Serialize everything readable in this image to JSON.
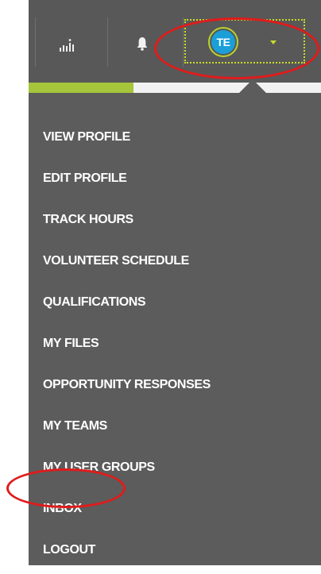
{
  "header": {
    "stats_icon": "bar-chart-icon",
    "notifications_icon": "bell-icon",
    "avatar_initials": "TE",
    "dropdown_icon": "caret-down-icon"
  },
  "progress": {
    "fraction": 0.36
  },
  "menu": {
    "items": [
      {
        "label": "VIEW PROFILE"
      },
      {
        "label": "EDIT PROFILE"
      },
      {
        "label": "TRACK HOURS"
      },
      {
        "label": "VOLUNTEER SCHEDULE"
      },
      {
        "label": "QUALIFICATIONS"
      },
      {
        "label": "MY FILES"
      },
      {
        "label": "OPPORTUNITY RESPONSES"
      },
      {
        "label": "MY TEAMS"
      },
      {
        "label": "MY USER GROUPS"
      },
      {
        "label": "INBOX"
      },
      {
        "label": "LOGOUT"
      }
    ]
  },
  "colors": {
    "header_bg": "#585858",
    "menu_bg": "#5c5c5c",
    "accent_green": "#a6c53a",
    "avatar_blue": "#1a9fd8",
    "annotation_red": "#e01b1b"
  }
}
